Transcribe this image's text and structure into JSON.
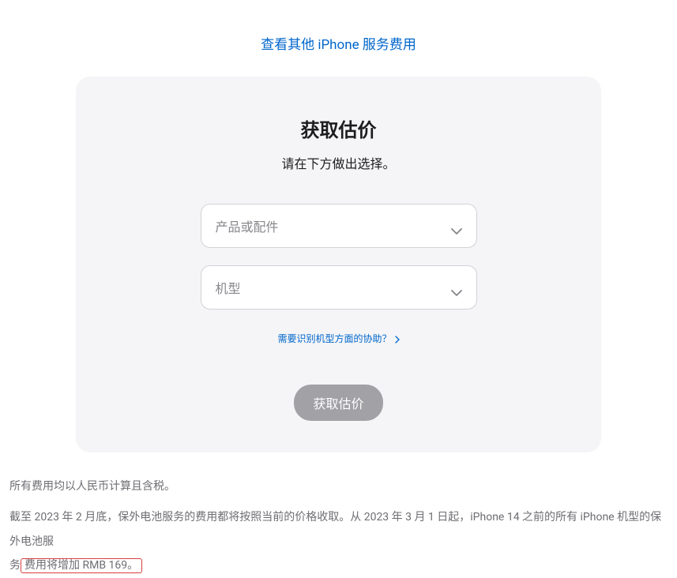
{
  "topLink": {
    "label": "查看其他 iPhone 服务费用"
  },
  "card": {
    "title": "获取估价",
    "subtitle": "请在下方做出选择。",
    "select1": {
      "placeholder": "产品或配件"
    },
    "select2": {
      "placeholder": "机型"
    },
    "helpLink": {
      "label": "需要识别机型方面的协助？"
    },
    "submitButton": {
      "label": "获取估价"
    }
  },
  "footer": {
    "line1": "所有费用均以人民币计算且含税。",
    "line2a": "截至 2023 年 2 月底，保外电池服务的费用都将按照当前的价格收取。从 2023 年 3 月 1 日起，iPhone 14 之前的所有 iPhone 机型的保外电池服",
    "line2b": "务",
    "highlighted": "费用将增加 RMB 169。"
  }
}
